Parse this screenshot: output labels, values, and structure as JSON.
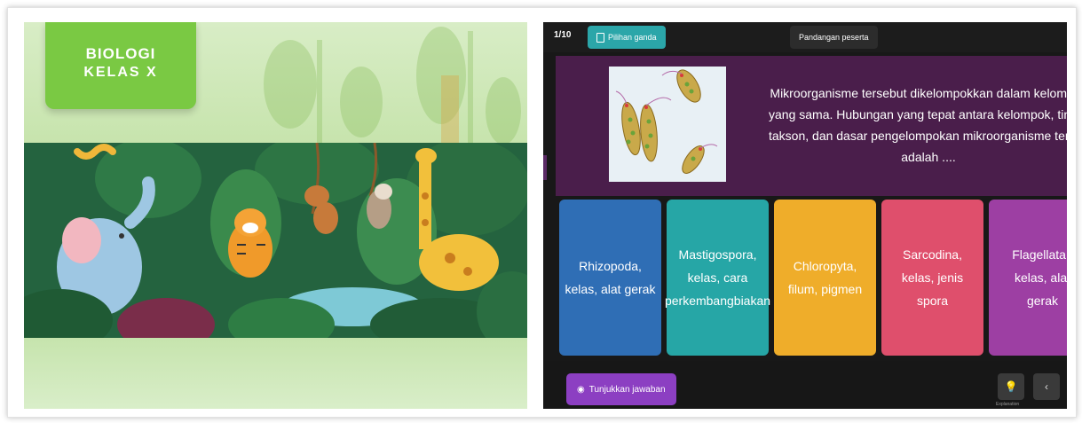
{
  "left_slide": {
    "title_line1": "BIOLOGI",
    "title_line2": "KELAS X"
  },
  "quiz": {
    "question_count": "1/10",
    "question_type": "Pilihan ganda",
    "participant_view": "Pandangan peserta",
    "question_lines": [
      "Mikroorganisme tersebut dikelompokkan dalam kelompok",
      "yang sama. Hubungan yang tepat antara kelompok, tingkat",
      "takson, dan dasar pengelompokan mikroorganisme tersebut",
      "adalah ...."
    ],
    "answers": [
      {
        "label": "Rhizopoda, kelas, alat gerak",
        "color": "#2f6eb5"
      },
      {
        "label": "Mastigospora, kelas, cara perkembangbiakan",
        "color": "#26a6a6"
      },
      {
        "label": "Chloropyta, filum, pigmen",
        "color": "#efad2a"
      },
      {
        "label": "Sarcodina, kelas, jenis spora",
        "color": "#df4f6c"
      },
      {
        "label": "Flagellata,, kelas, alat gerak",
        "color": "#9d3fa3"
      }
    ],
    "show_answer_button": "Tunjukkan jawaban",
    "explanation_label": "Explanation"
  },
  "colors": {
    "question_bg": "#4a1e4b",
    "type_pill": "#2ba6a9",
    "show_button": "#8c3fc2",
    "title_card": "#7ac943"
  }
}
